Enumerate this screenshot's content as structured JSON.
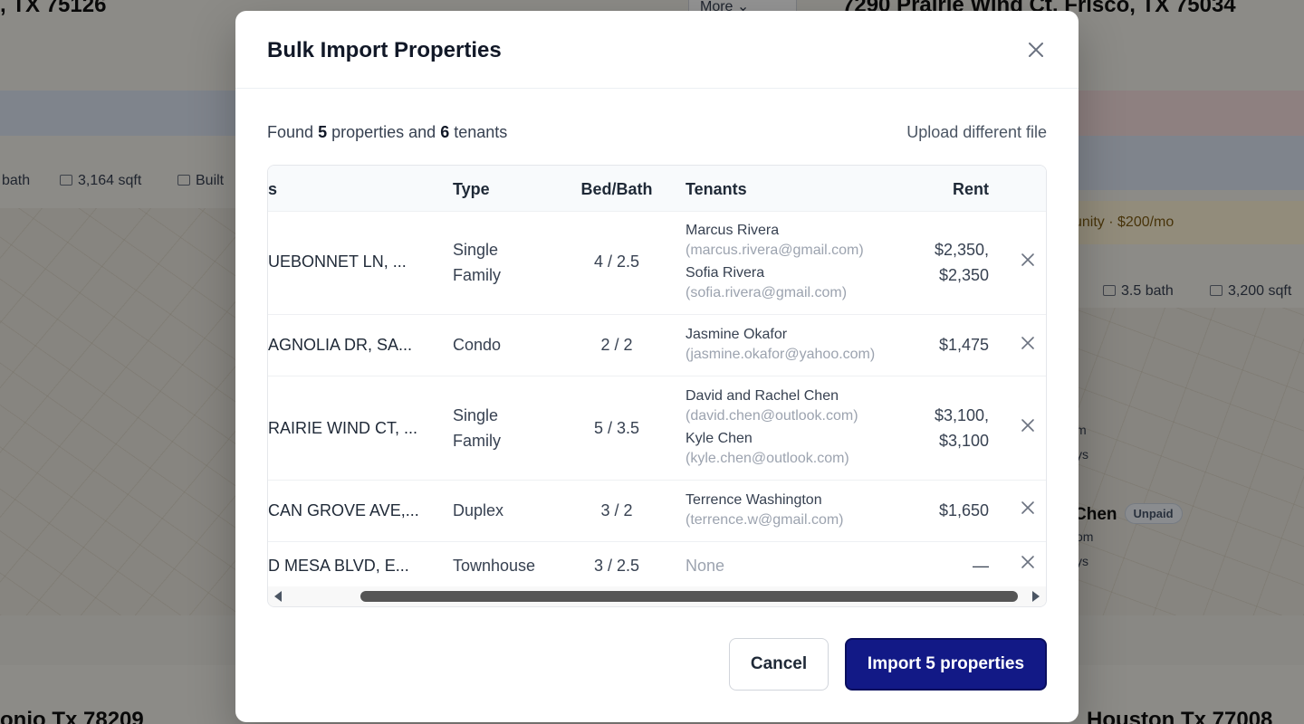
{
  "background": {
    "listing_top_left": ", TX 75126",
    "listing_top_right": "7290 Prairie Wind Ct, Frisco, TX 75034",
    "more_button": "More",
    "meta_left": [
      "bath",
      "3,164 sqft",
      "Built"
    ],
    "amenity_note": "unity · $200/mo",
    "meta_right": [
      "3.5 bath",
      "3,200 sqft"
    ],
    "tenant_fragment": "Chen",
    "tenant_badge": "Unpaid",
    "fragments": [
      "m",
      "ys",
      "om",
      "ys"
    ],
    "listing_bottom_left": "onio Tx 78209",
    "listing_bottom_right": "Houston Tx 77008"
  },
  "modal": {
    "title": "Bulk Import Properties",
    "summary": {
      "prefix": "Found",
      "property_count": "5",
      "middle": "properties and",
      "tenant_count": "6",
      "suffix": "tenants"
    },
    "upload_link": "Upload different file",
    "columns": {
      "address": "s",
      "type": "Type",
      "bedbath": "Bed/Bath",
      "tenants": "Tenants",
      "rent": "Rent"
    },
    "rows": [
      {
        "address": "UEBONNET LN, ...",
        "type_line1": "Single",
        "type_line2": "Family",
        "bedbath": "4 / 2.5",
        "tenants": [
          {
            "name": "Marcus Rivera",
            "email": "(marcus.rivera@gmail.com)"
          },
          {
            "name": "Sofia Rivera",
            "email": "(sofia.rivera@gmail.com)"
          }
        ],
        "rent_line1": "$2,350,",
        "rent_line2": "$2,350"
      },
      {
        "address": "AGNOLIA DR, SA...",
        "type_line1": "Condo",
        "bedbath": "2 / 2",
        "tenants": [
          {
            "name": "Jasmine Okafor",
            "email": "(jasmine.okafor@yahoo.com)"
          }
        ],
        "rent_line1": "$1,475"
      },
      {
        "address": "RAIRIE WIND CT, ...",
        "type_line1": "Single",
        "type_line2": "Family",
        "bedbath": "5 / 3.5",
        "tenants": [
          {
            "name": "David and Rachel Chen",
            "email": "(david.chen@outlook.com)"
          },
          {
            "name": "Kyle Chen",
            "email": "(kyle.chen@outlook.com)"
          }
        ],
        "rent_line1": "$3,100,",
        "rent_line2": "$3,100"
      },
      {
        "address": "CAN GROVE AVE,...",
        "type_line1": "Duplex",
        "bedbath": "3 / 2",
        "tenants": [
          {
            "name": "Terrence Washington",
            "email": "(terrence.w@gmail.com)"
          }
        ],
        "rent_line1": "$1,650"
      },
      {
        "address": "D MESA BLVD, E...",
        "type_line1": "Townhouse",
        "bedbath": "3 / 2.5",
        "tenants_none": "None",
        "rent_line1": "—"
      }
    ],
    "cancel_label": "Cancel",
    "import_label": "Import 5 properties",
    "colors": {
      "primary": "#121986",
      "overlay": "rgba(0,0,0,0.42)"
    }
  }
}
